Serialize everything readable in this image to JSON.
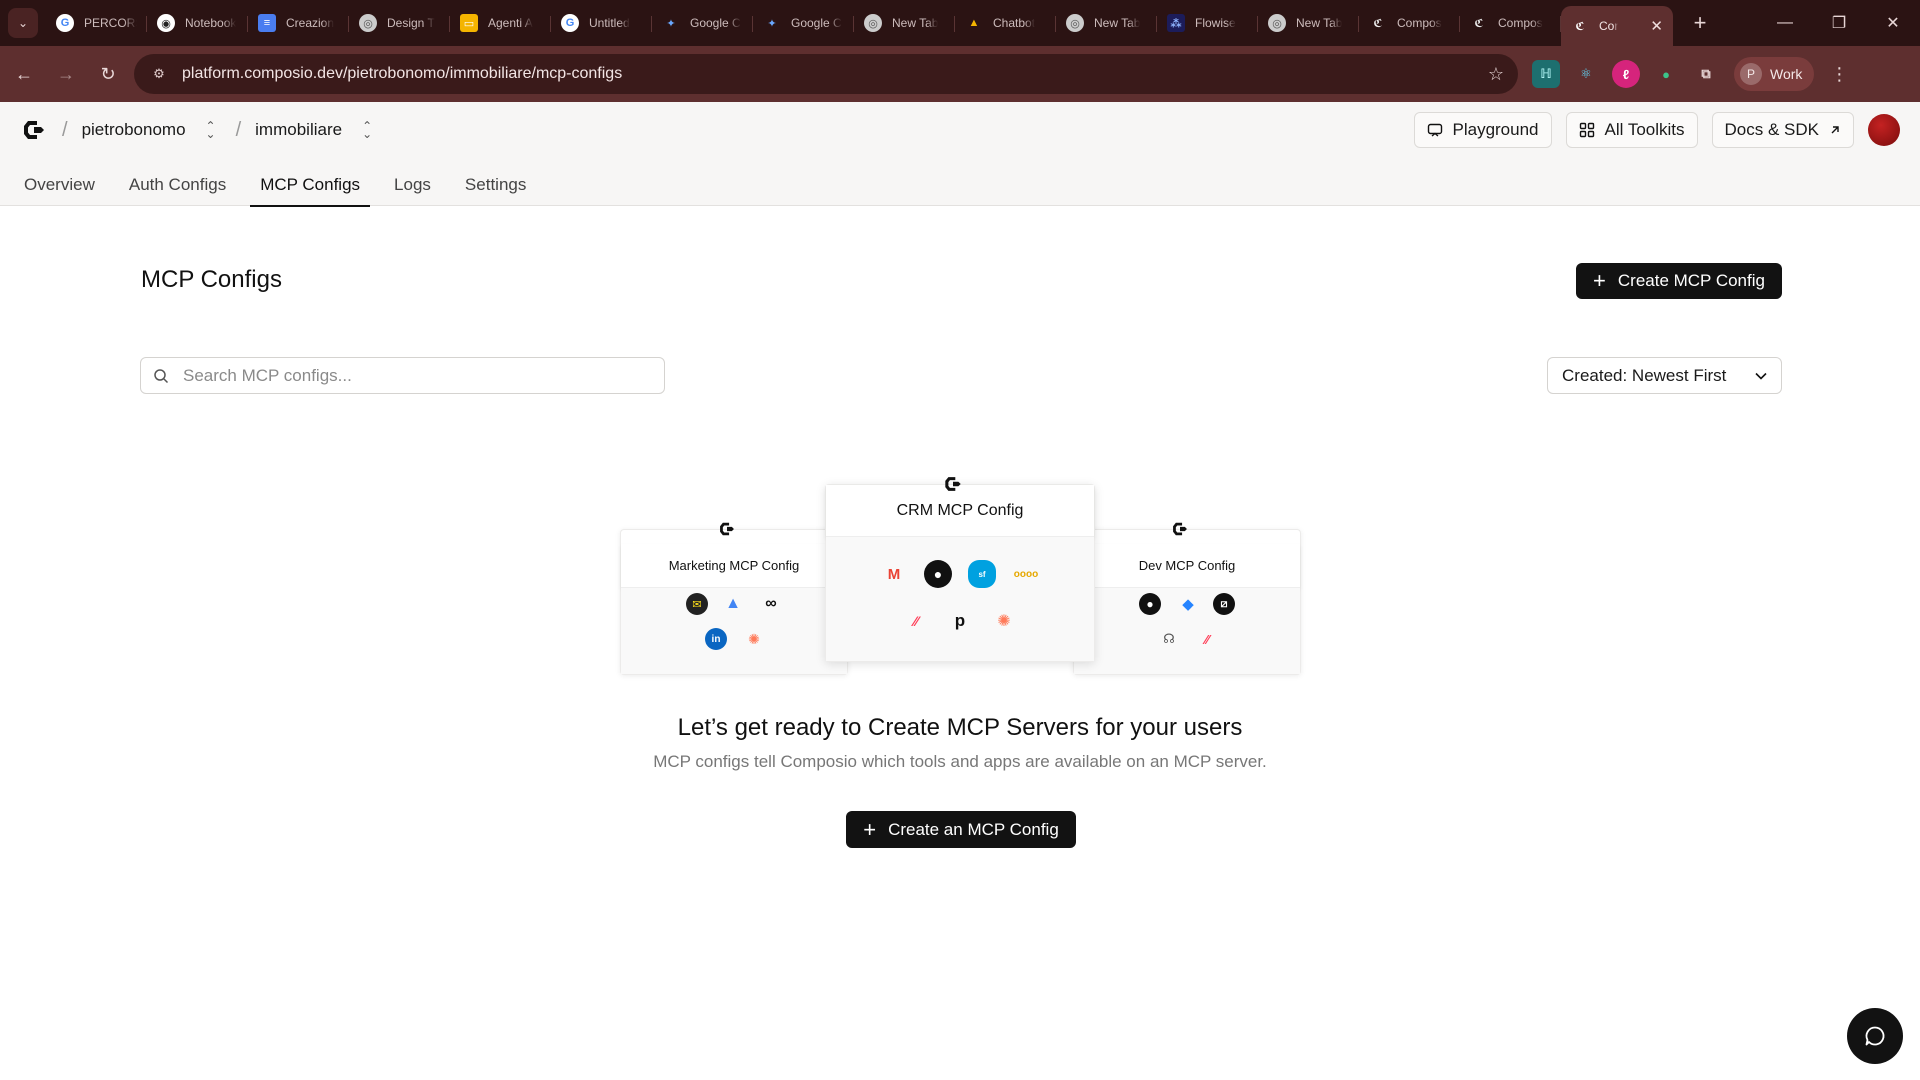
{
  "browser": {
    "tabs": [
      {
        "label": "PERCORS",
        "icon": "google-icon"
      },
      {
        "label": "Notebook",
        "icon": "notebooklm-icon"
      },
      {
        "label": "Creazion",
        "icon": "docs-icon"
      },
      {
        "label": "Design T",
        "icon": "chrome-icon"
      },
      {
        "label": "Agenti A",
        "icon": "slides-icon"
      },
      {
        "label": "Untitled",
        "icon": "google-icon"
      },
      {
        "label": "Google C",
        "icon": "gemini-icon"
      },
      {
        "label": "Google C",
        "icon": "gemini-icon"
      },
      {
        "label": "New Tab",
        "icon": "chrome-icon"
      },
      {
        "label": "Chatbot",
        "icon": "drive-icon"
      },
      {
        "label": "New Tab",
        "icon": "chrome-icon"
      },
      {
        "label": "Flowise",
        "icon": "flowise-icon"
      },
      {
        "label": "New Tab",
        "icon": "chrome-icon"
      },
      {
        "label": "Compos",
        "icon": "composio-icon"
      },
      {
        "label": "Compos",
        "icon": "composio-icon"
      }
    ],
    "active_tab": {
      "label": "Cor",
      "icon": "composio-icon"
    },
    "url": "platform.composio.dev/pietrobonomo/immobiliare/mcp-configs",
    "profile_initial": "P",
    "profile_label": "Work"
  },
  "header": {
    "org": "pietrobonomo",
    "project": "immobiliare",
    "actions": {
      "playground": "Playground",
      "all_toolkits": "All Toolkits",
      "docs": "Docs & SDK"
    }
  },
  "nav": {
    "tabs": [
      "Overview",
      "Auth Configs",
      "MCP Configs",
      "Logs",
      "Settings"
    ],
    "active": "MCP Configs"
  },
  "main": {
    "title": "MCP Configs",
    "create_button": "Create MCP Config",
    "search_placeholder": "Search MCP configs...",
    "sort_label": "Created: Newest First",
    "illustration": {
      "cards": [
        {
          "title": "Marketing MCP Config",
          "apps": [
            "mailchimp-icon",
            "google-ads-icon",
            "meta-icon",
            "linkedin-icon",
            "hubspot-icon"
          ]
        },
        {
          "title": "CRM MCP Config",
          "apps": [
            "gmail-icon",
            "github-icon",
            "salesforce-icon",
            "zoho-icon",
            "monday-icon",
            "pipedrive-icon",
            "hubspot-icon"
          ]
        },
        {
          "title": "Dev MCP Config",
          "apps": [
            "github-icon",
            "bitbucket-icon",
            "linear-icon",
            "sentry-icon",
            "monday-icon"
          ]
        }
      ]
    },
    "empty_headline": "Let’s get ready to Create MCP Servers for your users",
    "empty_subline": "MCP configs tell Composio which tools and apps are available on an MCP server.",
    "empty_button": "Create an MCP Config"
  },
  "colors": {
    "chrome_tabbar": "#2b1313",
    "chrome_toolbar": "#5e2f2f",
    "primary_button": "#121212",
    "header_bg": "#f7f6f5"
  }
}
